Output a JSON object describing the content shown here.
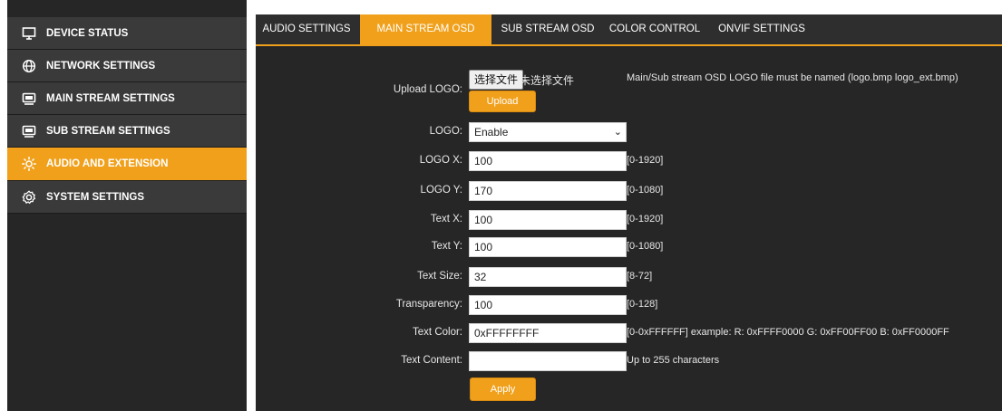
{
  "sidebar": {
    "items": [
      {
        "label": "DEVICE STATUS",
        "icon": "monitor-icon"
      },
      {
        "label": "NETWORK SETTINGS",
        "icon": "globe-icon"
      },
      {
        "label": "MAIN STREAM SETTINGS",
        "icon": "video-screen-icon"
      },
      {
        "label": "SUB STREAM SETTINGS",
        "icon": "video-screen-icon"
      },
      {
        "label": "AUDIO AND EXTENSION",
        "icon": "sun-icon",
        "active": true
      },
      {
        "label": "SYSTEM SETTINGS",
        "icon": "gear-icon"
      }
    ]
  },
  "tabs": [
    {
      "label": "AUDIO SETTINGS"
    },
    {
      "label": "MAIN STREAM OSD",
      "active": true
    },
    {
      "label": "SUB STREAM OSD"
    },
    {
      "label": "COLOR CONTROL"
    },
    {
      "label": "ONVIF SETTINGS"
    }
  ],
  "upload": {
    "label": "Upload LOGO:",
    "choose_button": "选择文件",
    "no_file_text": "未选择文件",
    "note": "Main/Sub stream OSD LOGO file must be named (logo.bmp logo_ext.bmp)",
    "upload_button": "Upload"
  },
  "form": {
    "logo": {
      "label": "LOGO:",
      "value": "Enable"
    },
    "logo_x": {
      "label": "LOGO X:",
      "value": "100",
      "hint": "[0-1920]"
    },
    "logo_y": {
      "label": "LOGO Y:",
      "value": "170",
      "hint": "[0-1080]"
    },
    "text_x": {
      "label": "Text X:",
      "value": "100",
      "hint": "[0-1920]"
    },
    "text_y": {
      "label": "Text Y:",
      "value": "100",
      "hint": "[0-1080]"
    },
    "text_size": {
      "label": "Text Size:",
      "value": "32",
      "hint": "[8-72]"
    },
    "transparency": {
      "label": "Transparency:",
      "value": "100",
      "hint": "[0-128]"
    },
    "text_color": {
      "label": "Text Color:",
      "value": "0xFFFFFFFF",
      "hint": "[0-0xFFFFFF] example: R: 0xFFFF0000 G: 0xFF00FF00 B: 0xFF0000FF"
    },
    "text_content": {
      "label": "Text Content:",
      "value": "",
      "hint": "Up to 255 characters"
    }
  },
  "apply_button": "Apply",
  "colors": {
    "accent": "#f0a01b",
    "panel": "#262626",
    "sidebar_item": "#3a3a3a"
  }
}
